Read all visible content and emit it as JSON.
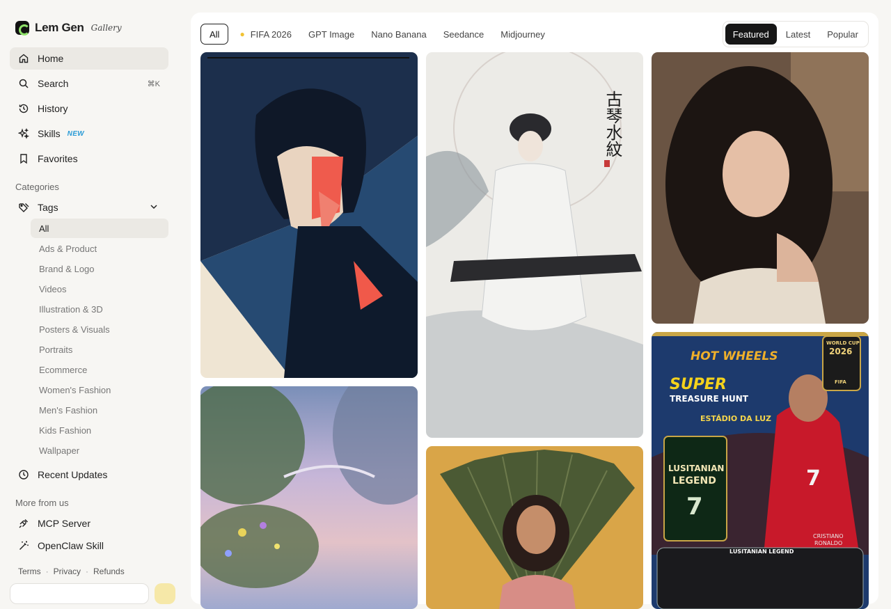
{
  "brand": {
    "name": "Lem Gen",
    "sub": "Gallery"
  },
  "nav": {
    "home": "Home",
    "search": "Search",
    "search_shortcut": "⌘K",
    "history": "History",
    "skills": "Skills",
    "skills_badge": "NEW",
    "favorites": "Favorites"
  },
  "categories_label": "Categories",
  "tags_label": "Tags",
  "tags": [
    "All",
    "Ads & Product",
    "Brand & Logo",
    "Videos",
    "Illustration & 3D",
    "Posters & Visuals",
    "Portraits",
    "Ecommerce",
    "Women's Fashion",
    "Men's Fashion",
    "Kids Fashion",
    "Wallpaper"
  ],
  "recent_updates": "Recent Updates",
  "more_label": "More from us",
  "more": {
    "mcp": "MCP Server",
    "openclaw": "OpenClaw Skill"
  },
  "footer": {
    "terms": "Terms",
    "privacy": "Privacy",
    "refunds": "Refunds",
    "sep": "·"
  },
  "filters": [
    "All",
    "FIFA 2026",
    "GPT Image",
    "Nano Banana",
    "Seedance",
    "Midjourney"
  ],
  "sort": [
    "Featured",
    "Latest",
    "Popular"
  ],
  "cards": {
    "poster_chinese_title": "古琴水紋",
    "hw_logo": "HOT WHEELS",
    "hw_title_1": "SUPER",
    "hw_title_2": "TREASURE HUNT",
    "hw_venue": "ESTÁDIO DA LUZ",
    "hw_badge_1": "WORLD CUP",
    "hw_badge_2": "2026",
    "hw_badge_3": "FIFA",
    "hw_legend_1": "LUSITANIAN",
    "hw_legend_2": "LEGEND",
    "hw_number": "7",
    "hw_name_1": "CRISTIANO",
    "hw_name_2": "RONALDO",
    "hw_pack_label": "LUSITANIAN LEGEND"
  },
  "colors": {
    "accent_dark": "#161616",
    "badge_blue": "#2a9bd6",
    "bulb": "#f1c232"
  }
}
